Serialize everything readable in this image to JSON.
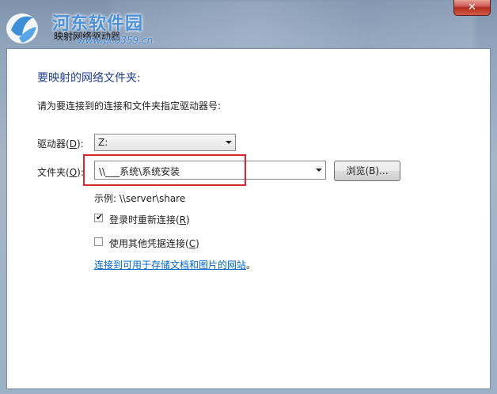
{
  "window": {
    "title": "映射网络驱动器",
    "close_glyph": "✕"
  },
  "watermark": {
    "site_name": "河东软件园",
    "url": "www.pc0359.cn"
  },
  "dialog": {
    "heading": "要映射的网络文件夹:",
    "instruction": "请为要连接到的连接和文件夹指定驱动器号:",
    "drive": {
      "label_prefix": "驱动器(",
      "label_key": "D",
      "label_suffix": "):",
      "value": "Z:"
    },
    "folder": {
      "label_prefix": "文件夹(",
      "label_key": "O",
      "label_suffix": "):",
      "value": "\\\\___系统\\系统安装"
    },
    "browse_button": {
      "label": "浏览(B)..."
    },
    "example": "示例: \\\\server\\share",
    "reconnect": {
      "label_prefix": "登录时重新连接(",
      "label_key": "R",
      "label_suffix": ")",
      "checked": true
    },
    "other_credentials": {
      "label_prefix": "使用其他凭据连接(",
      "label_key": "C",
      "label_suffix": ")",
      "checked": false
    },
    "storage_link": "连接到可用于存储文档和图片的网站",
    "link_period": "。"
  }
}
